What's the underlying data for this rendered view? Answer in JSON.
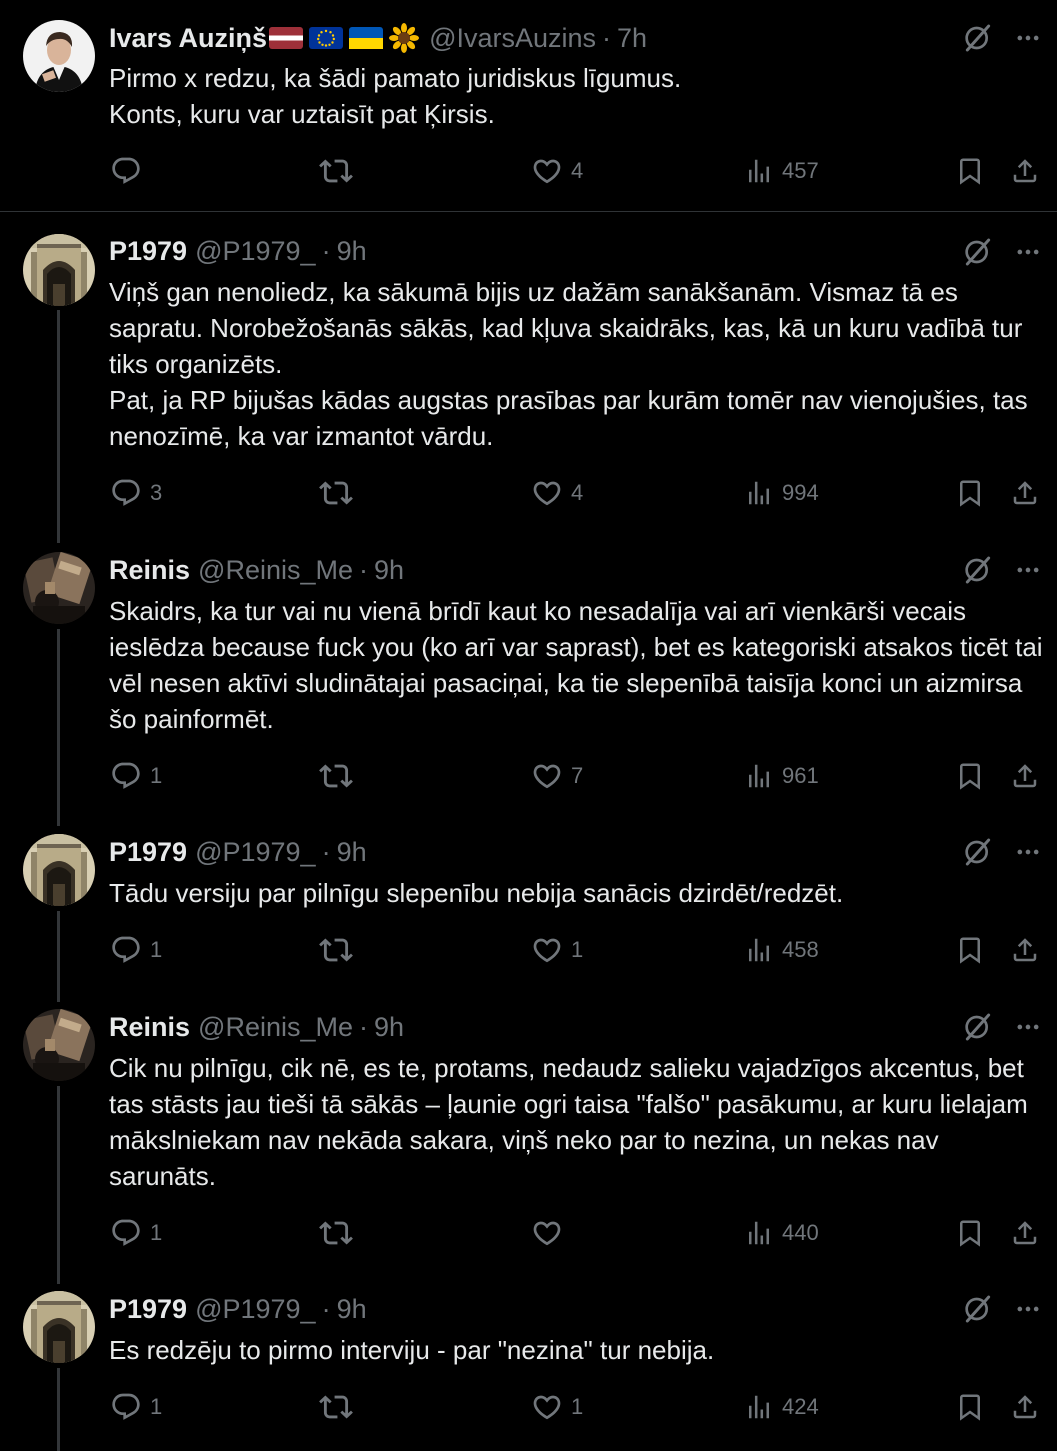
{
  "tweets": [
    {
      "name": "Ivars Auziņš",
      "handle": "@IvarsAuzins",
      "separator": "·",
      "time": "7h",
      "flags": [
        "latvia-flag",
        "eu-flag",
        "ukraine-flag",
        "sunflower"
      ],
      "text": "Pirmo x redzu, ka šādi pamato juridiskus līgumus.\nKonts, kuru var uztaisīt pat Ķirsis.",
      "replies": "",
      "retweets": "",
      "likes": "4",
      "views": "457"
    },
    {
      "name": "P1979",
      "handle": "@P1979_",
      "separator": "·",
      "time": "9h",
      "text": "Viņš gan nenoliedz, ka sākumā bijis uz dažām sanākšanām. Vismaz tā es sapratu. Norobežošanās sākās, kad kļuva skaidrāks, kas, kā un kuru vadībā tur tiks organizēts.\nPat, ja RP bijušas kādas augstas prasības par kurām tomēr nav vienojušies, tas nenozīmē, ka var izmantot vārdu.",
      "replies": "3",
      "retweets": "",
      "likes": "4",
      "views": "994"
    },
    {
      "name": "Reinis",
      "handle": "@Reinis_Me",
      "separator": "·",
      "time": "9h",
      "text": "Skaidrs, ka tur vai nu vienā brīdī kaut ko nesadalīja vai arī vienkārši vecais ieslēdza because fuck you (ko arī var saprast), bet es kategoriski atsakos ticēt tai vēl nesen aktīvi sludinātajai pasaciņai, ka tie slepenībā taisīja konci un aizmirsa šo painformēt.",
      "replies": "1",
      "retweets": "",
      "likes": "7",
      "views": "961"
    },
    {
      "name": "P1979",
      "handle": "@P1979_",
      "separator": "·",
      "time": "9h",
      "text": "Tādu versiju par pilnīgu slepenību nebija sanācis dzirdēt/redzēt.",
      "replies": "1",
      "retweets": "",
      "likes": "1",
      "views": "458"
    },
    {
      "name": "Reinis",
      "handle": "@Reinis_Me",
      "separator": "·",
      "time": "9h",
      "text": "Cik nu pilnīgu, cik nē, es te, protams, nedaudz salieku vajadzīgos akcentus, bet tas stāsts jau tieši tā sākās – ļaunie ogri taisa \"falšo\" pasākumu, ar kuru lielajam mākslniekam nav nekāda sakara, viņš neko par to nezina, un nekas nav sarunāts.",
      "replies": "1",
      "retweets": "",
      "likes": "",
      "views": "440"
    },
    {
      "name": "P1979",
      "handle": "@P1979_",
      "separator": "·",
      "time": "9h",
      "text": "Es redzēju to pirmo interviju - par \"nezina\" tur nebija.",
      "replies": "1",
      "retweets": "",
      "likes": "1",
      "views": "424"
    }
  ],
  "colors": {
    "background": "#000000",
    "text": "#e7e9ea",
    "muted": "#71767b",
    "divider": "#2f3336",
    "thread_line": "#333639"
  }
}
